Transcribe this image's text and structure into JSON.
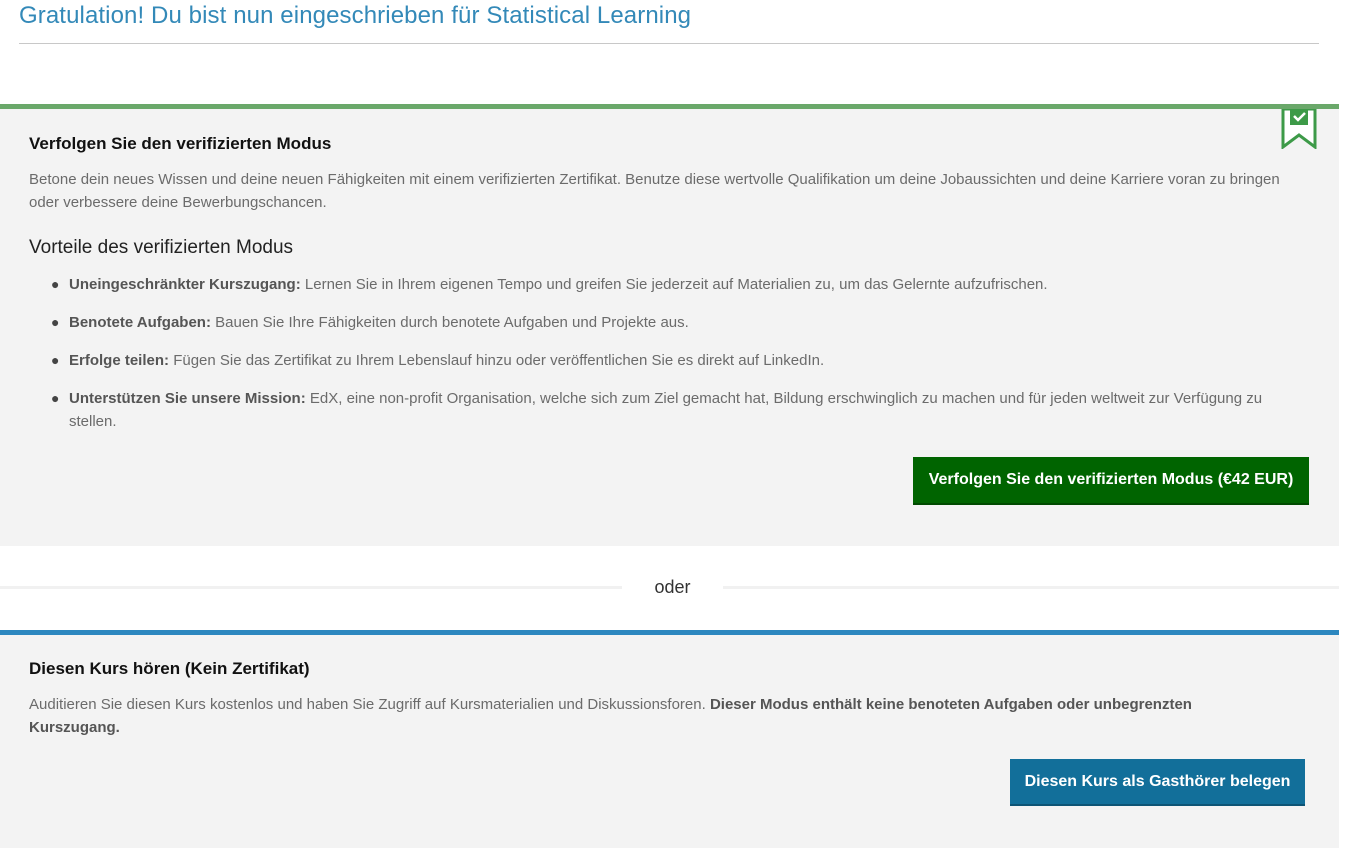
{
  "header": {
    "title": "Gratulation! Du bist nun eingeschrieben für Statistical Learning"
  },
  "verified": {
    "title": "Verfolgen Sie den verifizierten Modus",
    "description": "Betone dein neues Wissen und deine neuen Fähigkeiten mit einem verifizierten Zertifikat. Benutze diese wertvolle Qualifikation um deine Jobaussichten und deine Karriere voran zu bringen oder verbessere deine Bewerbungschancen.",
    "benefits_heading": "Vorteile des verifizierten Modus",
    "benefits": [
      {
        "label": "Uneingeschränkter Kurszugang:",
        "text": "Lernen Sie in Ihrem eigenen Tempo und greifen Sie jederzeit auf Materialien zu, um das Gelernte aufzufrischen."
      },
      {
        "label": "Benotete Aufgaben:",
        "text": "Bauen Sie Ihre Fähigkeiten durch benotete Aufgaben und Projekte aus."
      },
      {
        "label": "Erfolge teilen:",
        "text": "Fügen Sie das Zertifikat zu Ihrem Lebenslauf hinzu oder veröffentlichen Sie es direkt auf LinkedIn."
      },
      {
        "label": "Unterstützen Sie unsere Mission:",
        "text": "EdX, eine non-profit Organisation, welche sich zum Ziel gemacht hat, Bildung erschwinglich zu machen und für jeden weltweit zur Verfügung zu stellen."
      }
    ],
    "button_label": "Verfolgen Sie den verifizierten Modus (€42 EUR)",
    "ribbon_icon": "bookmark-check-icon",
    "accent_color": "#6aa86a"
  },
  "divider": {
    "label": "oder"
  },
  "audit": {
    "title": "Diesen Kurs hören (Kein Zertifikat)",
    "description_plain": "Auditieren Sie diesen Kurs kostenlos und haben Sie Zugriff auf Kursmaterialien und Diskussionsforen.",
    "description_bold": "Dieser Modus enthält keine benoteten Aufgaben oder unbegrenzten Kurszugang.",
    "button_label": "Diesen Kurs als Gasthörer belegen",
    "accent_color": "#2c87bf"
  },
  "colors": {
    "verified_button": "#006400",
    "audit_button": "#126f9a",
    "header_title": "#3389b8"
  }
}
